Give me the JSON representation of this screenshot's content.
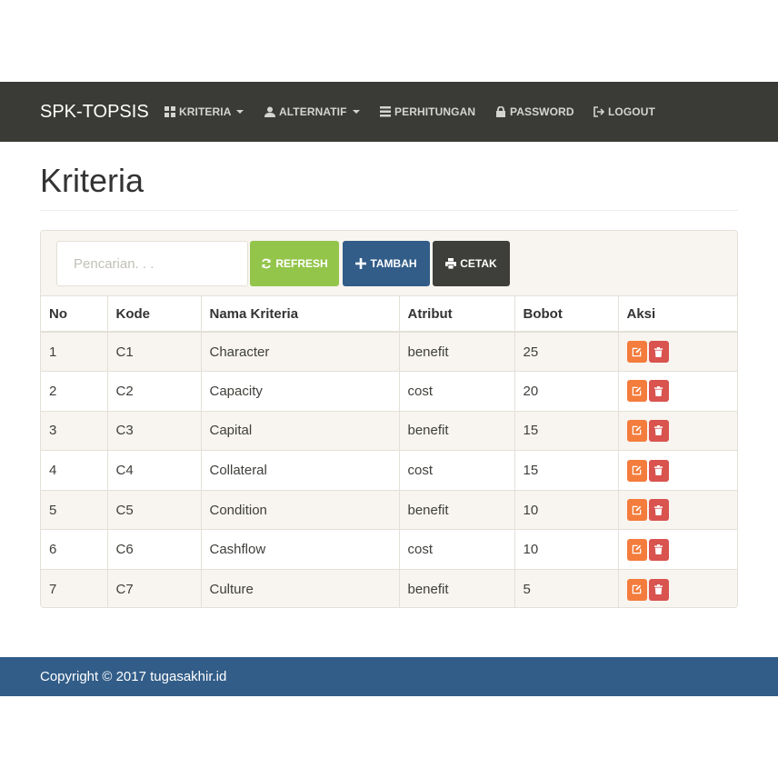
{
  "navbar": {
    "brand": "SPK-TOPSIS",
    "items": [
      {
        "label": "KRITERIA",
        "icon": "th-large-icon",
        "dropdown": true
      },
      {
        "label": "ALTERNATIF",
        "icon": "user-icon",
        "dropdown": true
      },
      {
        "label": "PERHITUNGAN",
        "icon": "list-icon",
        "dropdown": false
      },
      {
        "label": "PASSWORD",
        "icon": "lock-icon",
        "dropdown": false
      },
      {
        "label": "LOGOUT",
        "icon": "log-out-icon",
        "dropdown": false
      }
    ]
  },
  "page": {
    "title": "Kriteria"
  },
  "toolbar": {
    "search_placeholder": "Pencarian. . .",
    "search_value": "",
    "refresh_label": "REFRESH",
    "tambah_label": "TAMBAH",
    "cetak_label": "CETAK"
  },
  "table": {
    "headers": [
      "No",
      "Kode",
      "Nama Kriteria",
      "Atribut",
      "Bobot",
      "Aksi"
    ],
    "rows": [
      {
        "no": "1",
        "kode": "C1",
        "nama": "Character",
        "atribut": "benefit",
        "bobot": "25"
      },
      {
        "no": "2",
        "kode": "C2",
        "nama": "Capacity",
        "atribut": "cost",
        "bobot": "20"
      },
      {
        "no": "3",
        "kode": "C3",
        "nama": "Capital",
        "atribut": "benefit",
        "bobot": "15"
      },
      {
        "no": "4",
        "kode": "C4",
        "nama": "Collateral",
        "atribut": "cost",
        "bobot": "15"
      },
      {
        "no": "5",
        "kode": "C5",
        "nama": "Condition",
        "atribut": "benefit",
        "bobot": "10"
      },
      {
        "no": "6",
        "kode": "C6",
        "nama": "Cashflow",
        "atribut": "cost",
        "bobot": "10"
      },
      {
        "no": "7",
        "kode": "C7",
        "nama": "Culture",
        "atribut": "benefit",
        "bobot": "5"
      }
    ]
  },
  "footer": {
    "text": "Copyright © 2017 tugasakhir.id"
  },
  "colors": {
    "navbar_bg": "#3a3b36",
    "refresh": "#93c54b",
    "tambah": "#325d88",
    "cetak": "#3e3f3a",
    "edit": "#f47c3c",
    "delete": "#d9534f",
    "footer_bg": "#325d88",
    "striped_row": "#f8f5f0"
  }
}
